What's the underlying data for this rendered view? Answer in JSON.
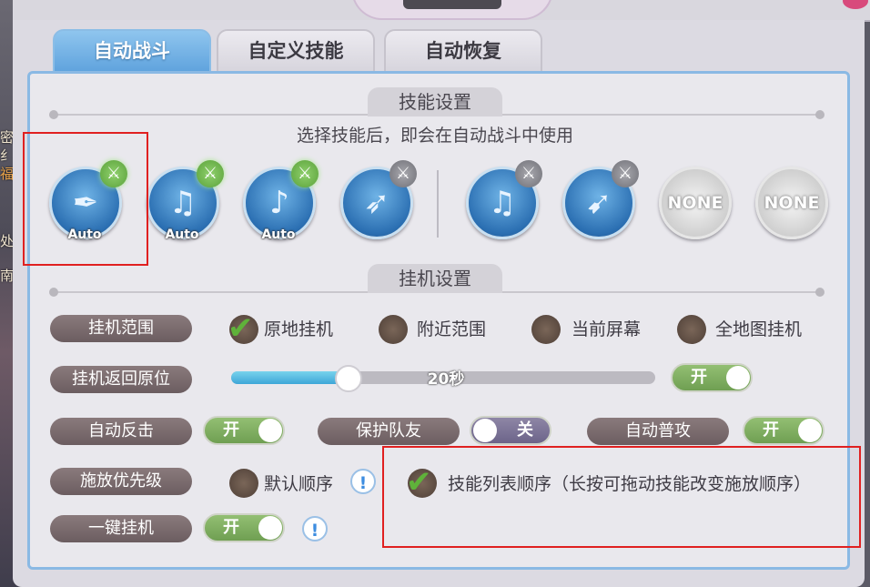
{
  "tabs": [
    {
      "label": "自动战斗",
      "active": true
    },
    {
      "label": "自定义技能",
      "active": false
    },
    {
      "label": "自动恢复",
      "active": false
    }
  ],
  "skill_section": {
    "title": "技能设置",
    "hint": "选择技能后，即会在自动战斗中使用",
    "skills": [
      {
        "icon": "feather-pen-skill-icon",
        "label": "Auto",
        "enabled": true
      },
      {
        "icon": "music-note-skill-icon",
        "label": "Auto",
        "enabled": true
      },
      {
        "icon": "sound-wave-skill-icon",
        "label": "Auto",
        "enabled": true
      },
      {
        "icon": "bow-skill-icon",
        "label": "",
        "enabled": false
      },
      {
        "icon": "music-note-skill-icon",
        "label": "",
        "enabled": false
      },
      {
        "icon": "arrows-skill-icon",
        "label": "",
        "enabled": false
      },
      {
        "icon": "none-skill-icon",
        "text": "NONE",
        "enabled": false
      },
      {
        "icon": "none-skill-icon",
        "text": "NONE",
        "enabled": false
      }
    ]
  },
  "idle_section": {
    "title": "挂机设置",
    "range": {
      "label": "挂机范围",
      "options": [
        "原地挂机",
        "附近范围",
        "当前屏幕",
        "全地图挂机"
      ],
      "selected": "原地挂机"
    },
    "return_position": {
      "label": "挂机返回原位",
      "value_text": "20秒",
      "fraction": 0.28,
      "toggle": "开"
    },
    "auto_counter": {
      "label": "自动反击",
      "toggle": "开"
    },
    "protect_team": {
      "label": "保护队友",
      "toggle": "关"
    },
    "auto_attack": {
      "label": "自动普攻",
      "toggle": "开"
    },
    "cast_priority": {
      "label": "施放优先级",
      "options": [
        "默认顺序",
        "技能列表顺序（长按可拖动技能改变施放顺序）"
      ],
      "selected": "技能列表顺序（长按可拖动技能改变施放顺序）"
    },
    "one_key": {
      "label": "一键挂机",
      "toggle": "开"
    }
  },
  "side_text": [
    "密",
    "纟",
    "福",
    "处",
    "南"
  ],
  "colors": {
    "accent": "#5ea2dd",
    "toggle_on": "#6f9f52",
    "toggle_off": "#6c6489",
    "highlight": "#e02020"
  }
}
